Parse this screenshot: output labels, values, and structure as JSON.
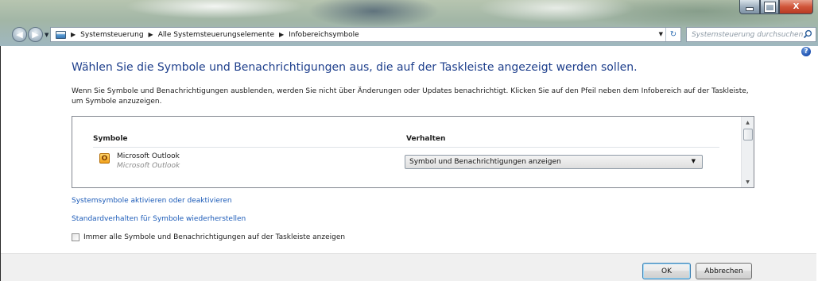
{
  "window": {
    "controls": {
      "minimize": "minimize",
      "maximize": "maximize",
      "close": "X"
    }
  },
  "navigation": {
    "breadcrumbs": [
      "Systemsteuerung",
      "Alle Systemsteuerungselemente",
      "Infobereichsymbole"
    ],
    "search_placeholder": "Systemsteuerung durchsuchen"
  },
  "main": {
    "help_glyph": "?",
    "title": "Wählen Sie die Symbole und Benachrichtigungen aus, die auf der Taskleiste angezeigt werden sollen.",
    "description_line1": "Wenn Sie Symbole und Benachrichtigungen ausblenden, werden Sie nicht über Änderungen oder Updates benachrichtigt. Klicken Sie auf den Pfeil neben dem Infobereich auf der Taskleiste,",
    "description_line2": "um Symbole anzuzeigen.",
    "table": {
      "columns": [
        "Symbole",
        "Verhalten"
      ],
      "rows": [
        {
          "icon_glyph": "O",
          "icon": "outlook-icon",
          "name": "Microsoft Outlook",
          "subtitle": "Microsoft Outlook",
          "behavior": "Symbol und Benachrichtigungen anzeigen"
        }
      ]
    },
    "links": [
      "Systemsymbole aktivieren oder deaktivieren",
      "Standardverhalten für Symbole wiederherstellen"
    ],
    "checkbox": {
      "label": "Immer alle Symbole und Benachrichtigungen auf der Taskleiste anzeigen",
      "checked": false
    }
  },
  "footer": {
    "ok_label": "OK",
    "cancel_label": "Abbrechen"
  },
  "colors": {
    "title": "#1e3f8c",
    "link": "#1c5bb8",
    "close_button": "#d0553a"
  }
}
